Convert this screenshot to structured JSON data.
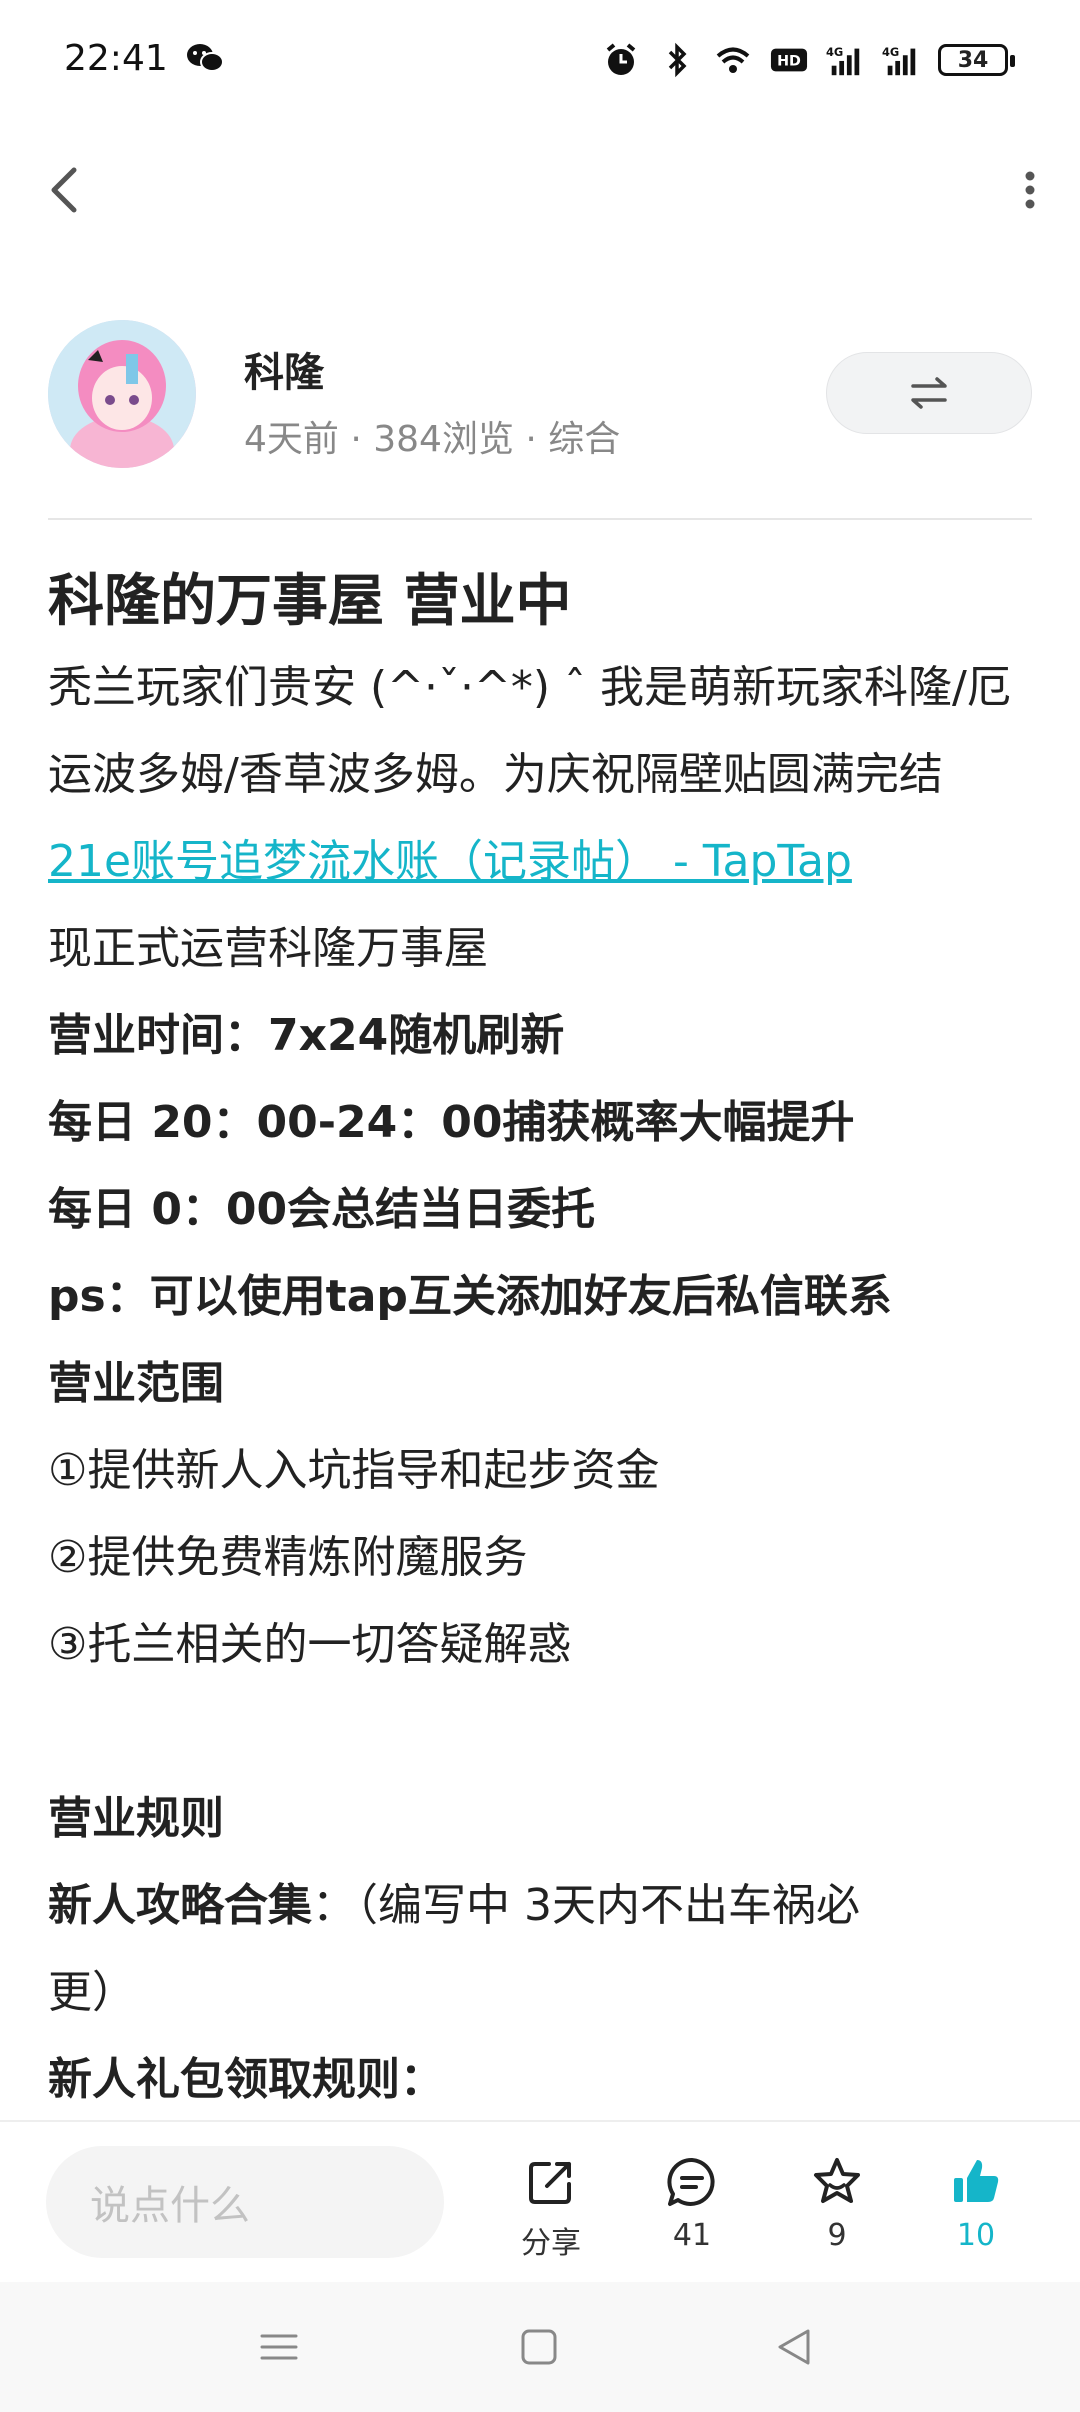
{
  "status_bar": {
    "time": "22:41",
    "battery": "34"
  },
  "post": {
    "author_name": "科隆",
    "meta": "4天前 · 384浏览 · 综合",
    "title": "科隆的万事屋 营业中",
    "lines": {
      "intro1": "秃兰玩家们贵安 (^·ˇ·^*) ˆ 我是萌新玩家科隆/厄",
      "intro2": "运波多姆/香草波多姆。为庆祝隔壁贴圆满完结",
      "link": "21e账号追梦流水账（记录帖） - TapTap",
      "l4": "现正式运营科隆万事屋",
      "l5": "营业时间：7x24随机刷新",
      "l6": "每日 20：00-24：00捕获概率大幅提升",
      "l7": "每日 0：00会总结当日委托",
      "l8": "ps：可以使用tap互关添加好友后私信联系",
      "l9": "营业范围",
      "l10": "①提供新人入坑指导和起步资金",
      "l11": "②提供免费精炼附魔服务",
      "l12": "③托兰相关的一切答疑解惑",
      "l13": "营业规则",
      "l14_bold": "新人攻略合集",
      "l14_rest": "：（编写中 3天内不出车祸必",
      "l15": "更）",
      "l16": "新人礼包领取规则："
    }
  },
  "bottom_bar": {
    "comment_placeholder": "说点什么",
    "share_label": "分享",
    "comments_count": "41",
    "favorites_count": "9",
    "likes_count": "10",
    "accent_color": "#15b5c9"
  }
}
